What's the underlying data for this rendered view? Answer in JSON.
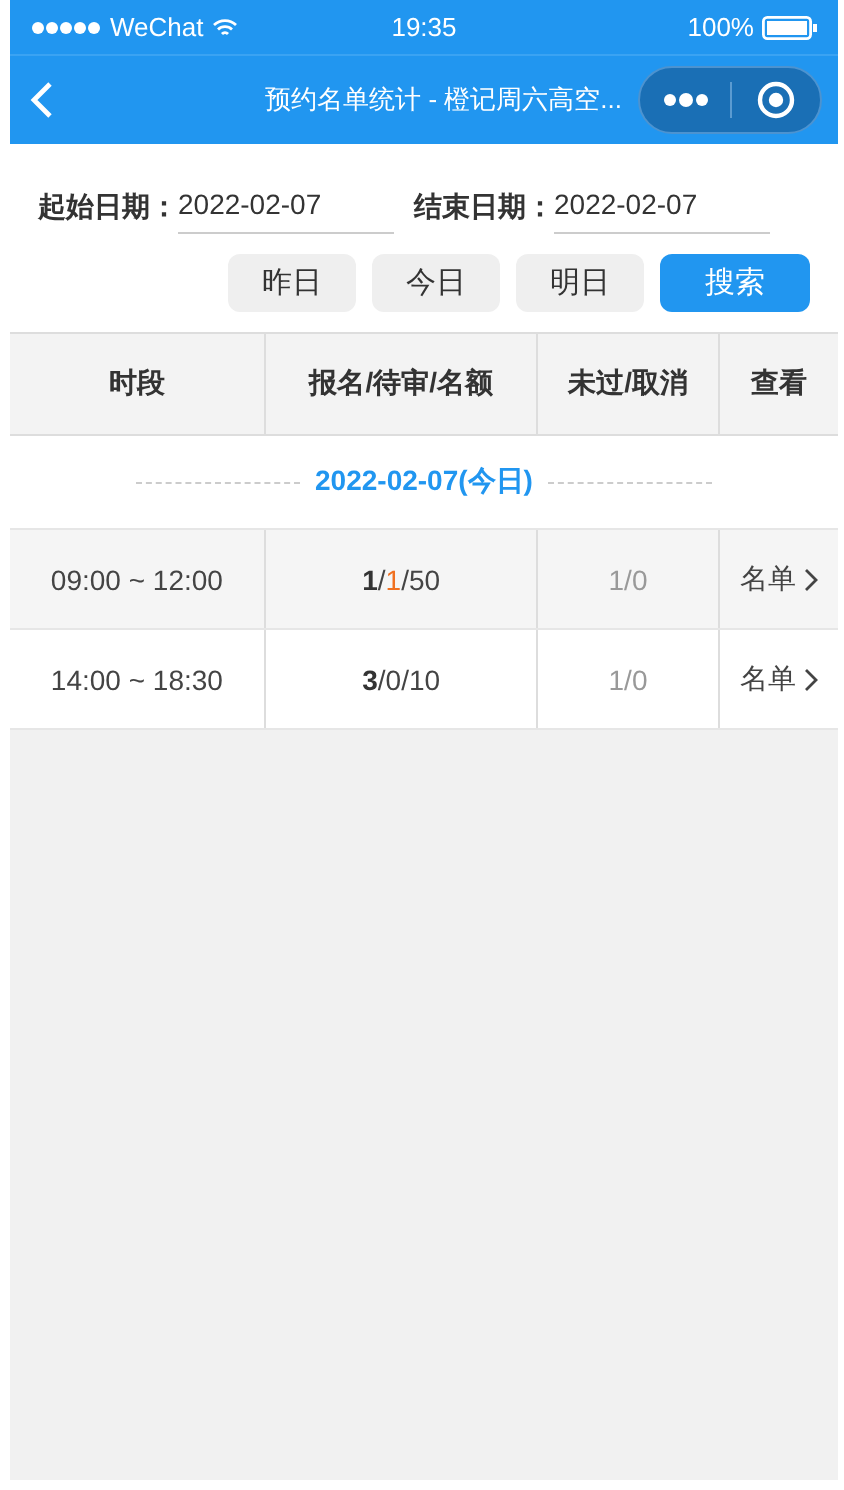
{
  "status_bar": {
    "carrier": "WeChat",
    "time": "19:35",
    "battery": "100%"
  },
  "nav": {
    "title": "预约名单统计 - 橙记周六高空..."
  },
  "filters": {
    "start_label": "起始日期：",
    "start_value": "2022-02-07",
    "end_label": "结束日期：",
    "end_value": "2022-02-07"
  },
  "buttons": [
    {
      "label": "昨日",
      "kind": "plain"
    },
    {
      "label": "今日",
      "kind": "plain"
    },
    {
      "label": "明日",
      "kind": "plain"
    },
    {
      "label": "搜索",
      "kind": "primary"
    }
  ],
  "table": {
    "columns": [
      "时段",
      "报名/待审/名额",
      "未过/取消",
      "查看"
    ],
    "count_separator": "/",
    "group_date": "2022-02-07",
    "group_tag": "(今日)",
    "rows": [
      {
        "time": "09:00 ~ 12:00",
        "signed": "1",
        "pending": "1",
        "pending_highlight": true,
        "quota": "50",
        "rejected_cancelled": "1/0",
        "view": "名单"
      },
      {
        "time": "14:00 ~ 18:30",
        "signed": "3",
        "pending": "0",
        "pending_highlight": false,
        "quota": "10",
        "rejected_cancelled": "1/0",
        "view": "名单"
      }
    ]
  }
}
